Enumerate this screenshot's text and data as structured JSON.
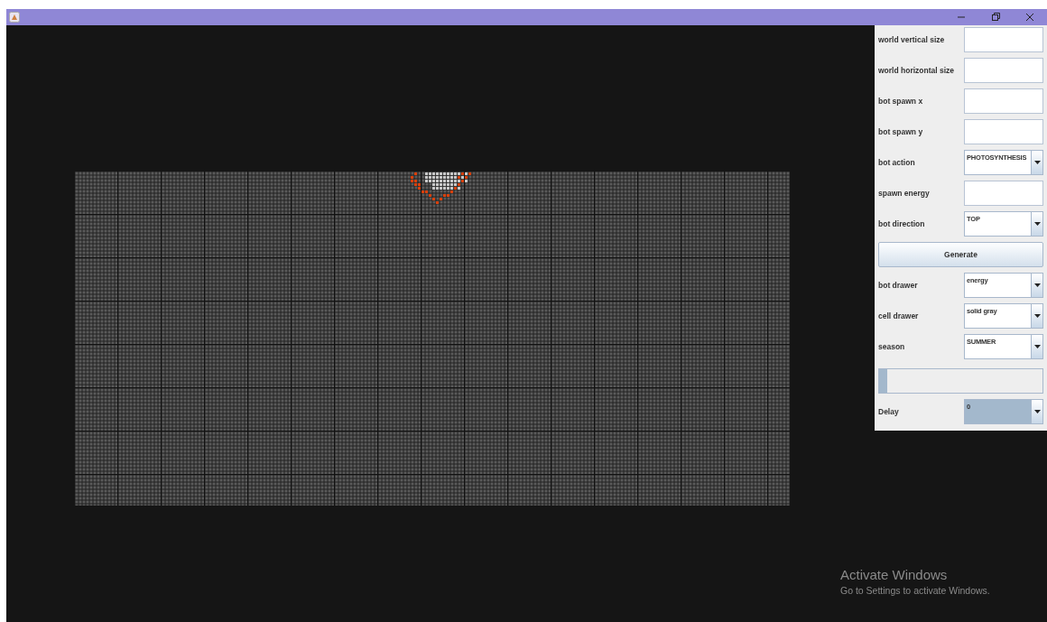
{
  "panel": {
    "rows": [
      {
        "kind": "text",
        "label": "world vertical size"
      },
      {
        "kind": "text",
        "label": "world horizontal size"
      },
      {
        "kind": "text",
        "label": "bot spawn x"
      },
      {
        "kind": "text",
        "label": "bot spawn y"
      },
      {
        "kind": "combo",
        "label": "bot action",
        "value": "PHOTOSYNTHESIS",
        "focused": false
      },
      {
        "kind": "text",
        "label": "spawn energy"
      },
      {
        "kind": "combo",
        "label": "bot direction",
        "value": "TOP",
        "focused": false
      },
      {
        "kind": "button",
        "label": "Generate"
      },
      {
        "kind": "combo",
        "label": "bot drawer",
        "value": "energy",
        "focused": false
      },
      {
        "kind": "combo",
        "label": "cell drawer",
        "value": "solid gray",
        "focused": false
      },
      {
        "kind": "combo",
        "label": "season",
        "value": "SUMMER",
        "focused": false
      },
      {
        "kind": "progress",
        "level": 0.05
      },
      {
        "kind": "combo",
        "label": "Delay",
        "value": "0",
        "focused": true
      }
    ]
  },
  "os_notice": {
    "title": "Activate Windows",
    "text": "Go to Settings to activate Windows."
  }
}
